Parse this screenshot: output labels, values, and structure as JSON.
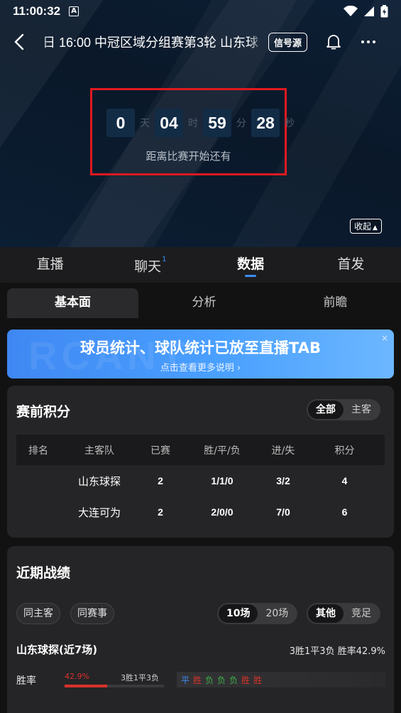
{
  "status": {
    "time": "11:00:32",
    "sim_label": "A"
  },
  "header": {
    "title": "日 16:00 中冠区域分组赛第3轮 山东球",
    "signal_button": "信号源"
  },
  "countdown": {
    "days": "0",
    "days_unit": "天",
    "hours": "04",
    "hours_unit": "时",
    "minutes": "59",
    "minutes_unit": "分",
    "seconds": "28",
    "seconds_unit": "秒",
    "caption": "距离比赛开始还有",
    "collapse_label": "收起"
  },
  "main_tabs": [
    {
      "label": "直播"
    },
    {
      "label": "聊天",
      "badge": "1"
    },
    {
      "label": "数据"
    },
    {
      "label": "首发"
    }
  ],
  "sub_tabs": [
    {
      "label": "基本面"
    },
    {
      "label": "分析"
    },
    {
      "label": "前瞻"
    }
  ],
  "banner": {
    "watermark": "RCANT",
    "title": "球员统计、球队统计已放至直播TAB",
    "subtitle": "点击查看更多说明 ›",
    "close": "×"
  },
  "standings": {
    "title": "赛前积分",
    "filters": [
      "全部",
      "主客"
    ],
    "columns": [
      "排名",
      "主客队",
      "已赛",
      "胜/平/负",
      "进/失",
      "积分"
    ],
    "rows": [
      {
        "rank": "",
        "team": "山东球探",
        "played": "2",
        "wdl": "1/1/0",
        "gf_ga": "3/2",
        "points": "4"
      },
      {
        "rank": "",
        "team": "大连可为",
        "played": "2",
        "wdl": "2/0/0",
        "gf_ga": "7/0",
        "points": "6"
      }
    ]
  },
  "recent": {
    "title": "近期战绩",
    "chips": [
      "同主客",
      "同赛事"
    ],
    "count_options": [
      "10场",
      "20场"
    ],
    "type_options": [
      "其他",
      "竞足"
    ],
    "team_label": "山东球探(近7场)",
    "team_summary": "3胜1平3负   胜率42.9%",
    "win_rate_label": "胜率",
    "win_rate_text": "42.9%",
    "win_rate_value": 0.429,
    "record_text": "3胜1平3负",
    "form": [
      "平",
      "胜",
      "负",
      "负",
      "负",
      "胜",
      "胜"
    ],
    "colors": {
      "win": "#d8322b",
      "draw": "#3d8df5",
      "loss": "#3fae49",
      "accent": "#3d8df5"
    }
  }
}
